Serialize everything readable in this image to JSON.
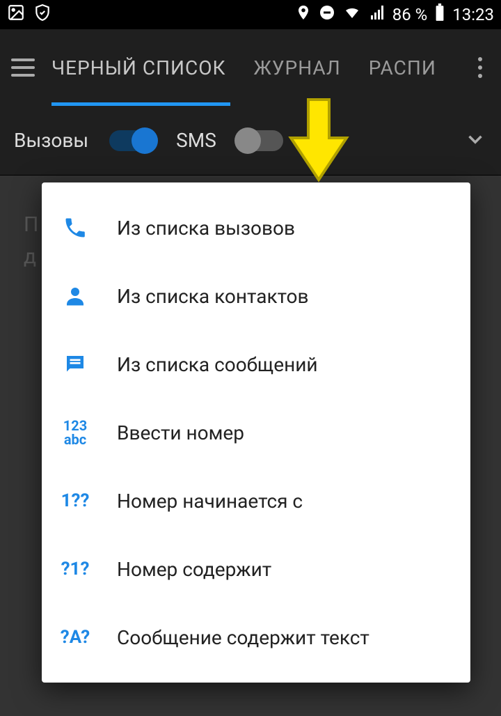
{
  "status": {
    "battery_pct": "86 %",
    "time": "13:23"
  },
  "tabs": {
    "blacklist": "ЧЕРНЫЙ СПИСОК",
    "journal": "ЖУРНАЛ",
    "schedule": "РАСПИ"
  },
  "toggles": {
    "calls_label": "Вызовы",
    "sms_label": "SMS",
    "calls_on": true,
    "sms_on": false
  },
  "bg_lines": {
    "l1": "П",
    "l2": "д"
  },
  "menu": {
    "from_calls": "Из списка вызовов",
    "from_contacts": "Из списка контактов",
    "from_messages": "Из списка сообщений",
    "enter_number": "Ввести номер",
    "starts_with": "Номер начинается с",
    "contains": "Номер содержит",
    "msg_contains": "Сообщение содержит текст",
    "icon_enter_l1": "123",
    "icon_enter_l2": "abc",
    "icon_starts": "1??",
    "icon_contains": "?1?",
    "icon_msg": "?A?"
  }
}
